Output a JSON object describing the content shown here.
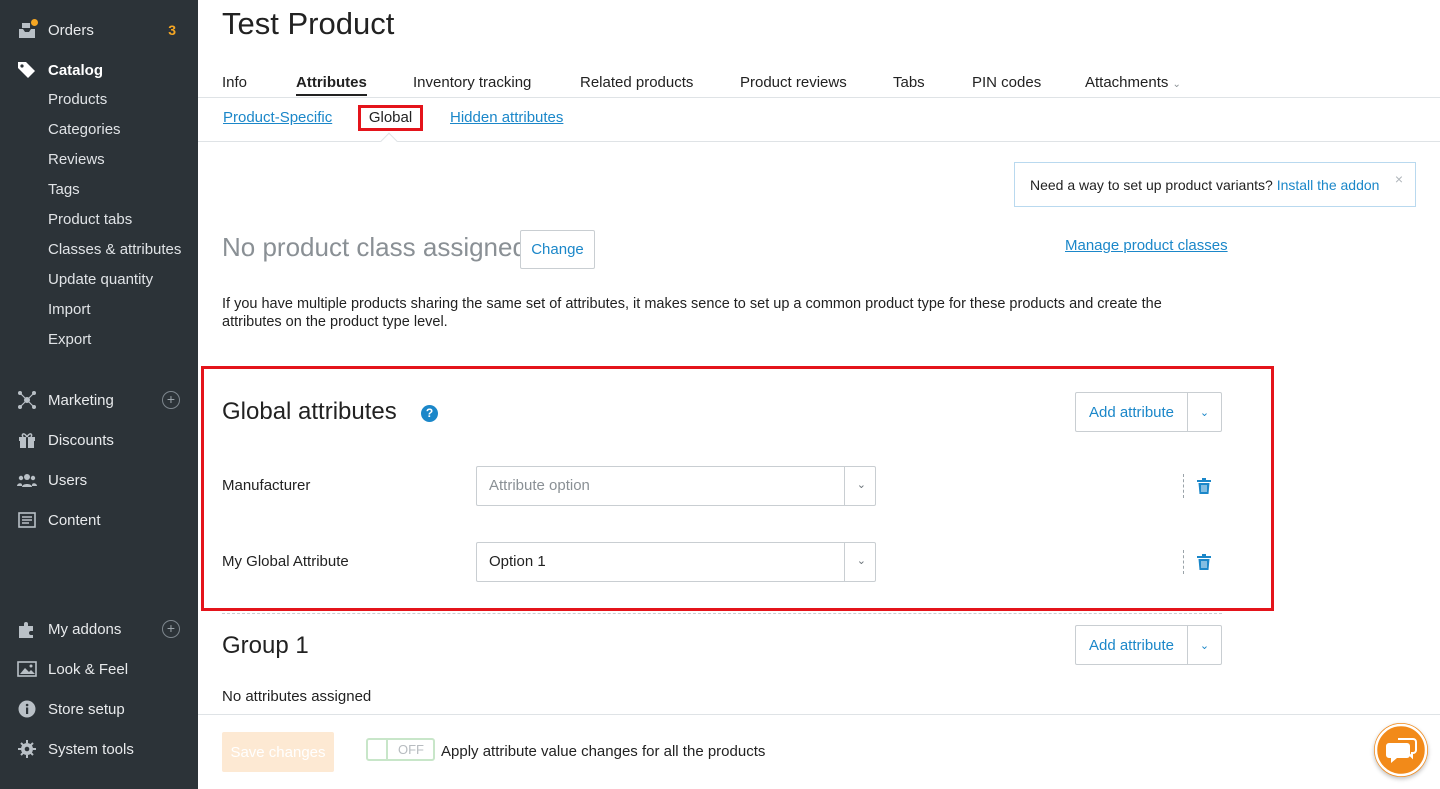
{
  "sidebar": {
    "orders": {
      "label": "Orders",
      "badge": "3"
    },
    "catalog": {
      "label": "Catalog"
    },
    "catalog_items": [
      "Products",
      "Categories",
      "Reviews",
      "Tags",
      "Product tabs",
      "Classes & attributes",
      "Update quantity",
      "Import",
      "Export"
    ],
    "marketing": {
      "label": "Marketing"
    },
    "discounts": {
      "label": "Discounts"
    },
    "users": {
      "label": "Users"
    },
    "content": {
      "label": "Content"
    },
    "my_addons": {
      "label": "My addons"
    },
    "look_feel": {
      "label": "Look & Feel"
    },
    "store_setup": {
      "label": "Store setup"
    },
    "system_tools": {
      "label": "System tools"
    }
  },
  "page": {
    "title": "Test Product"
  },
  "tabs": [
    "Info",
    "Attributes",
    "Inventory tracking",
    "Related products",
    "Product reviews",
    "Tabs",
    "PIN codes",
    "Attachments"
  ],
  "subtabs": {
    "product_specific": "Product-Specific",
    "global": "Global",
    "hidden": "Hidden attributes"
  },
  "notice": {
    "text": "Need a way to set up product variants?",
    "link": "Install the addon",
    "close": "×"
  },
  "product_class": {
    "title": "No product class assigned",
    "change_button": "Change",
    "manage_link": "Manage product classes"
  },
  "description": "If you have multiple products sharing the same set of attributes, it makes sence to set up a common product type for these products and create the attributes on the product type level.",
  "global_attributes": {
    "title": "Global attributes",
    "help": "?",
    "add_button": "Add attribute",
    "rows": [
      {
        "label": "Manufacturer",
        "value": "Attribute option",
        "placeholder": true
      },
      {
        "label": "My Global Attribute",
        "value": "Option 1",
        "placeholder": false
      }
    ]
  },
  "group1": {
    "title": "Group 1",
    "add_button": "Add attribute",
    "empty_text": "No attributes assigned"
  },
  "footer": {
    "save_button": "Save changes",
    "toggle_state": "OFF",
    "apply_label": "Apply attribute value changes for all the products"
  },
  "colors": {
    "accent": "#1b87c9",
    "highlight": "#e4141b",
    "sidebar_bg": "#2c3338",
    "badge": "#f5a623",
    "chat": "#f28a19"
  }
}
